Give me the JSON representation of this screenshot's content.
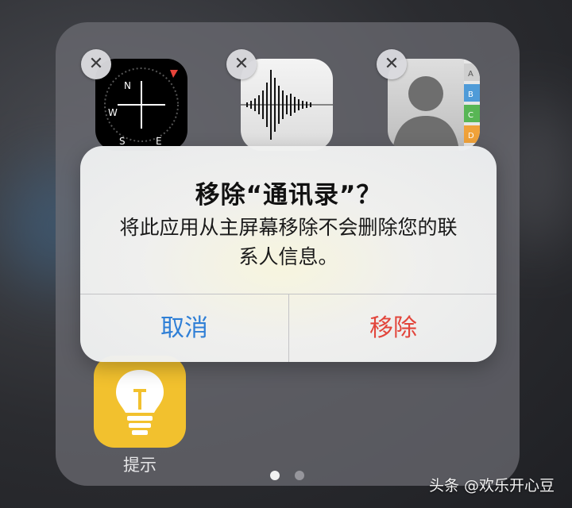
{
  "folder": {
    "apps": [
      {
        "name": "指南针",
        "icon": "compass-icon"
      },
      {
        "name": "语音备忘录",
        "icon": "voice-memos-icon"
      },
      {
        "name": "通讯录",
        "icon": "contacts-icon",
        "index_letters": [
          "A",
          "B",
          "C",
          "D"
        ]
      },
      {
        "name": "提示",
        "label": "提示",
        "icon": "tips-icon"
      }
    ],
    "compass_letters": {
      "n": "N",
      "w": "W",
      "s": "S",
      "e": "E"
    },
    "delete_badge_glyph": "✕",
    "page_indicator": {
      "pages": 2,
      "current": 1
    }
  },
  "alert": {
    "title": "移除“通讯录”？",
    "message_line1": "将此应用从主屏幕移除不会删除您的联",
    "message_line2": "系人信息。",
    "cancel_label": "取消",
    "remove_label": "移除",
    "cancel_color": "#2f7fd6",
    "remove_color": "#e2453b"
  },
  "watermark": {
    "text": "头条 @欢乐开心豆"
  }
}
